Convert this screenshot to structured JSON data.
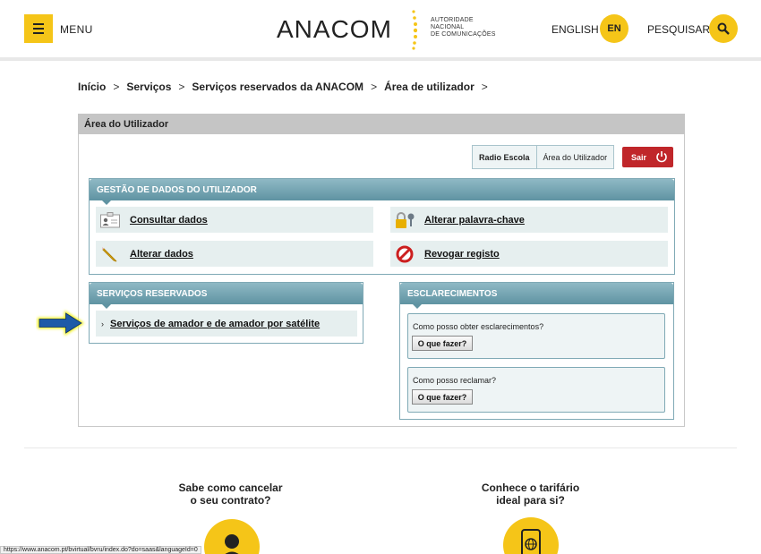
{
  "header": {
    "menu_label": "MENU",
    "logo_text": "ANACOM",
    "logo_sub": [
      "AUTORIDADE",
      "NACIONAL",
      "DE COMUNICAÇÕES"
    ],
    "lang_label": "ENGLISH",
    "lang_button": "EN",
    "search_label": "PESQUISAR",
    "accent_color": "#f5c518"
  },
  "breadcrumb": [
    "Início",
    "Serviços",
    "Serviços reservados da ANACOM",
    "Área de utilizador"
  ],
  "panel": {
    "title": "Área do Utilizador",
    "tabs": [
      {
        "label": "Radio Escola",
        "active": true
      },
      {
        "label": "Área do Utilizador",
        "active": false
      }
    ],
    "logout_label": "Sair"
  },
  "user_data_box": {
    "title": "GESTÃO DE DADOS DO UTILIZADOR",
    "items": [
      {
        "label": "Consultar dados",
        "icon": "id-card-icon"
      },
      {
        "label": "Alterar palavra-chave",
        "icon": "lock-key-icon"
      },
      {
        "label": "Alterar dados",
        "icon": "pencil-icon"
      },
      {
        "label": "Revogar registo",
        "icon": "prohibited-icon"
      }
    ]
  },
  "services_box": {
    "title": "SERVIÇOS RESERVADOS",
    "items": [
      {
        "label": "Serviços de amador e de amador por satélite"
      }
    ]
  },
  "faq_box": {
    "title": "ESCLARECIMENTOS",
    "items": [
      {
        "question": "Como posso obter esclarecimentos?",
        "button": "O que fazer?"
      },
      {
        "question": "Como posso reclamar?",
        "button": "O que fazer?"
      }
    ]
  },
  "promos": [
    {
      "line1": "Sabe como cancelar",
      "line2": "o seu contrato?",
      "icon": "person-icon"
    },
    {
      "line1": "Conhece o tarifário",
      "line2": "ideal para si?",
      "icon": "phone-globe-icon"
    }
  ],
  "status_url": "https://www.anacom.pt/bvirtual/bvru/index.do?do=saas&languageId=0"
}
